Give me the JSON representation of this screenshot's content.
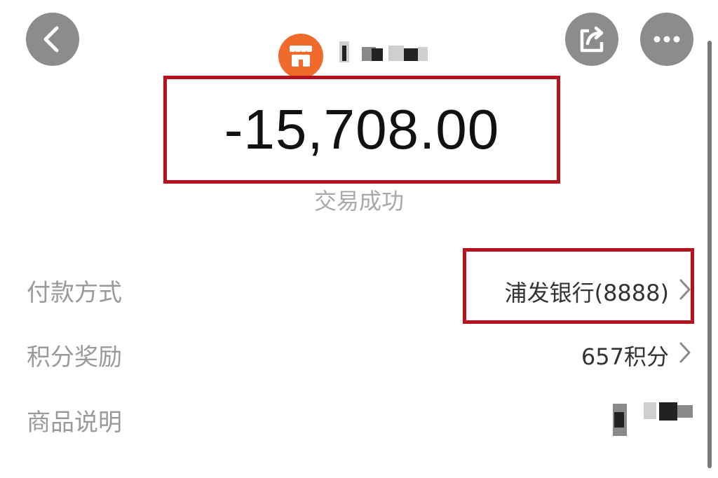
{
  "header": {
    "back_icon": "chevron-left-icon",
    "share_icon": "share-icon",
    "more_icon": "more-dots-icon",
    "merchant_icon": "shop-icon",
    "merchant_logo_color": "#f06b2b"
  },
  "transaction": {
    "amount": "-15,708.00",
    "status": "交易成功"
  },
  "details": [
    {
      "label": "付款方式",
      "value": "浦发银行(8888)"
    },
    {
      "label": "积分奖励",
      "value": "657积分"
    },
    {
      "label": "商品说明",
      "value": ""
    }
  ],
  "colors": {
    "highlight_border": "#b5121b",
    "button_gray": "#8c8c8c"
  }
}
